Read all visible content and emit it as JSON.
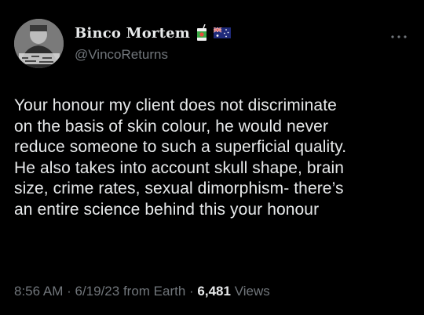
{
  "author": {
    "display_name": "Binco Mortem",
    "handle": "@VincoReturns",
    "avatar_icon": "profile-avatar",
    "badge_icon": "juice-box-icon",
    "flag_icon": "australia-flag-icon"
  },
  "menu": {
    "more_icon": "more-horizontal-icon"
  },
  "tweet": {
    "lines": [
      "Your honour my client does not discriminate",
      "on the basis of skin colour, he would never",
      "reduce someone to such a superficial quality.",
      "He also takes into account skull shape, brain",
      "size, crime rates, sexual dimorphism- there’s",
      "an entire science behind this your honour"
    ]
  },
  "meta": {
    "time": "8:56 AM",
    "sep1": " · ",
    "date": "6/19/23",
    "source": " from Earth",
    "sep2": " · ",
    "views_count": "6,481",
    "views_label": " Views"
  },
  "colors": {
    "background": "#000000",
    "text": "#e7e9ea",
    "muted": "#71767b"
  }
}
